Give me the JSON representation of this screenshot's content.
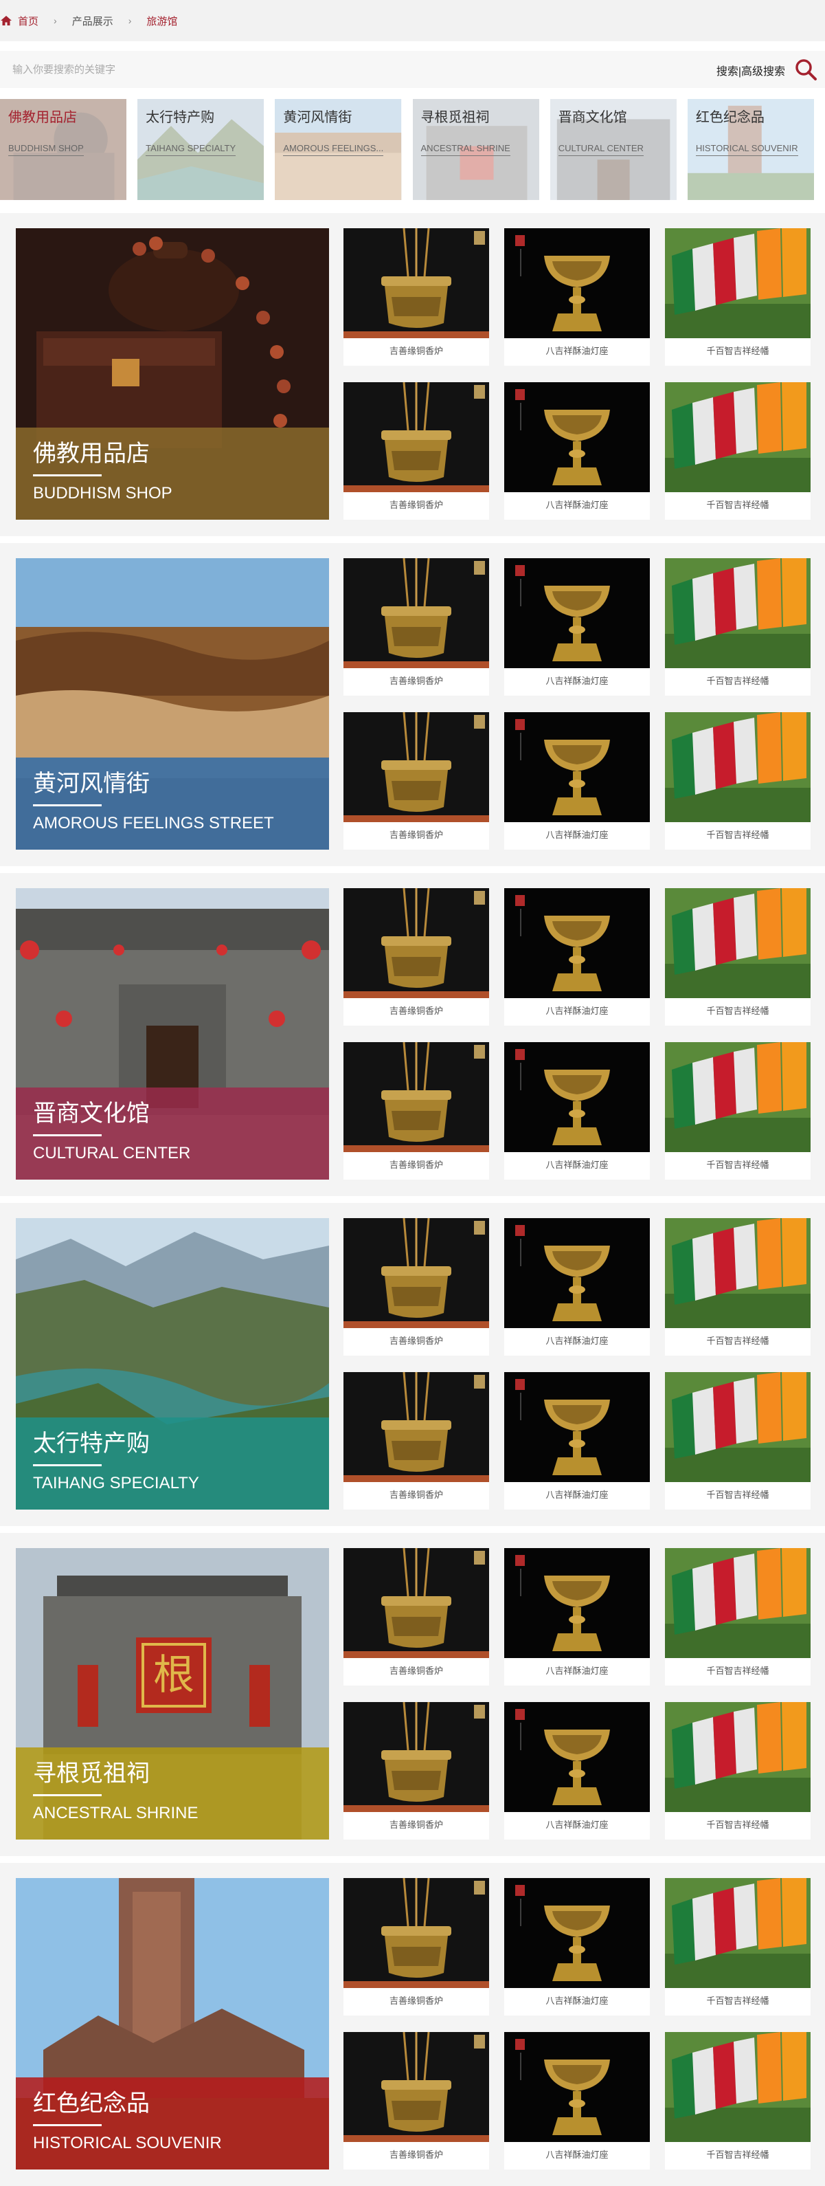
{
  "breadcrumb": {
    "home": "首页",
    "products": "产品展示",
    "current": "旅游馆"
  },
  "search": {
    "placeholder": "输入你要搜索的关键字",
    "search_label": "搜索",
    "divider": "|",
    "advanced_label": "高级搜索"
  },
  "categories": [
    {
      "cn": "佛教用品店",
      "en": "BUDDHISM SHOP"
    },
    {
      "cn": "太行特产购",
      "en": "TAIHANG SPECIALTY"
    },
    {
      "cn": "黄河风情街",
      "en": "AMOROUS FEELINGS..."
    },
    {
      "cn": "寻根觅祖祠",
      "en": "ANCESTRAL SHRINE"
    },
    {
      "cn": "晋商文化馆",
      "en": "CULTURAL CENTER"
    },
    {
      "cn": "红色纪念品",
      "en": "HISTORICAL SOUVENIR"
    }
  ],
  "sections": [
    {
      "cn": "佛教用品店",
      "en": "BUDDHISM SHOP",
      "tint": "#8a6a2c"
    },
    {
      "cn": "黄河风情街",
      "en": "AMOROUS FEELINGS STREET",
      "tint": "#2f6ba8"
    },
    {
      "cn": "晋商文化馆",
      "en": "CULTURAL CENTER",
      "tint": "#9a2c4b"
    },
    {
      "cn": "太行特产购",
      "en": "TAIHANG SPECIALTY",
      "tint": "#1f9188"
    },
    {
      "cn": "寻根觅祖祠",
      "en": "ANCESTRAL SHRINE",
      "tint": "#b39a12"
    },
    {
      "cn": "红色纪念品",
      "en": "HISTORICAL SOUVENIR",
      "tint": "#b41d1d"
    }
  ],
  "products": [
    {
      "name": "吉善缘铜香炉",
      "icon": "incense-burner"
    },
    {
      "name": "八吉祥酥油灯座",
      "icon": "butter-lamp"
    },
    {
      "name": "千百智吉祥经幡",
      "icon": "prayer-flags"
    }
  ],
  "colors": {
    "accent": "#a4222f"
  }
}
